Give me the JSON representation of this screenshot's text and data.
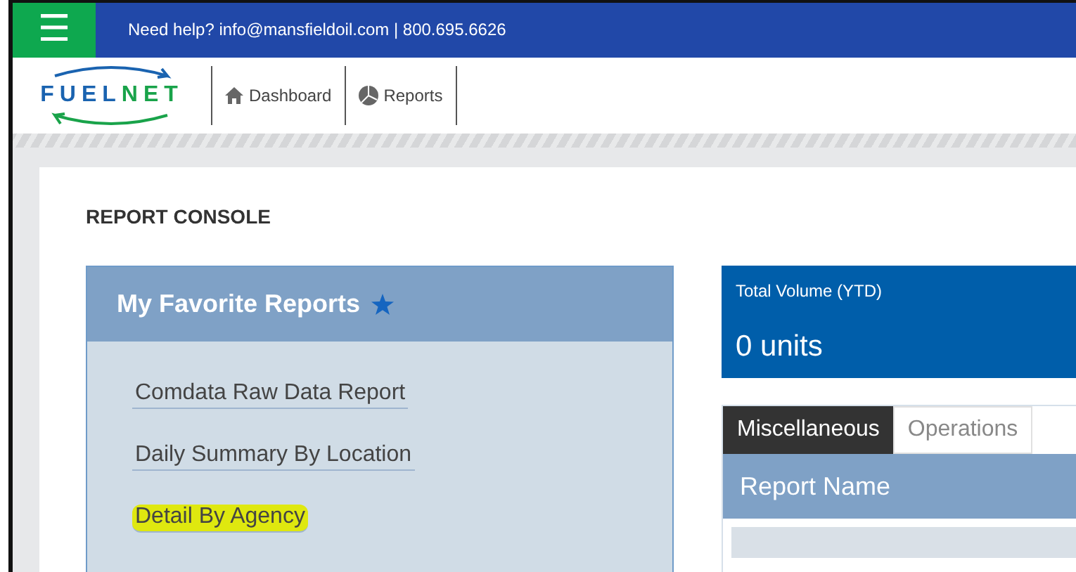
{
  "top_bar": {
    "menu_icon": "☰",
    "help_text": "Need help? info@mansfieldoil.com | 800.695.6626"
  },
  "nav": {
    "logo": [
      "FUEL",
      "NET"
    ],
    "items": [
      {
        "label": "Dashboard",
        "kind": "home"
      },
      {
        "label": "Reports",
        "kind": "chart"
      }
    ]
  },
  "page_title": "REPORT CONSOLE",
  "favorites": {
    "title": "My Favorite Reports",
    "items": [
      {
        "label": "Comdata Raw Data Report",
        "highlighted": false
      },
      {
        "label": "Daily Summary By Location",
        "highlighted": false
      },
      {
        "label": "Detail By Agency",
        "highlighted": true
      }
    ]
  },
  "volume_card": {
    "label": "Total Volume (YTD)",
    "value": "0 units"
  },
  "tabs": [
    {
      "label": "Miscellaneous",
      "selected": true
    },
    {
      "label": "Operations",
      "selected": false
    }
  ],
  "table": {
    "columns": [
      "Report Name"
    ]
  }
}
